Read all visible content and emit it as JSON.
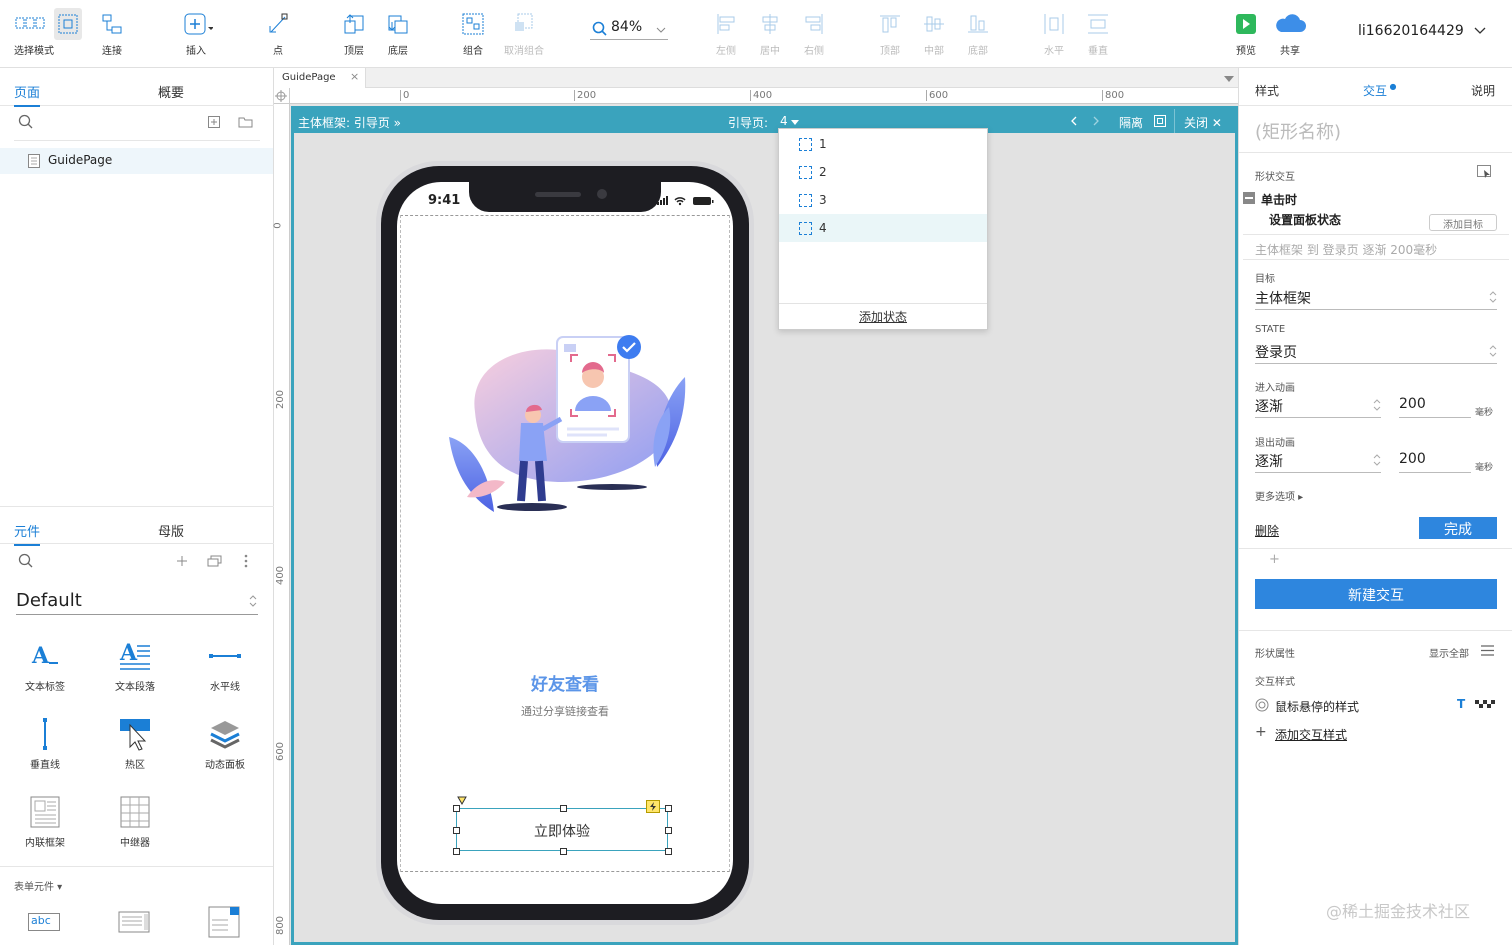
{
  "toolbar": {
    "select_mode": "选择模式",
    "connect": "连接",
    "insert": "插入",
    "point": "点",
    "top": "顶层",
    "bottom": "底层",
    "group": "组合",
    "ungroup": "取消组合",
    "zoom": "84%",
    "align_left": "左侧",
    "align_center": "居中",
    "align_right": "右侧",
    "align_top": "顶部",
    "align_middle": "中部",
    "align_bottom": "底部",
    "dist_h": "水平",
    "dist_v": "垂直",
    "preview": "预览",
    "share": "共享",
    "user": "li16620164429"
  },
  "left": {
    "tabs": [
      "页面",
      "概要"
    ],
    "page_item": "GuidePage",
    "lib_tabs": [
      "元件",
      "母版"
    ],
    "library": "Default",
    "widgets": [
      {
        "label": "文本标签",
        "icon": "text-label-icon"
      },
      {
        "label": "文本段落",
        "icon": "text-paragraph-icon"
      },
      {
        "label": "水平线",
        "icon": "horizontal-line-icon"
      },
      {
        "label": "垂直线",
        "icon": "vertical-line-icon"
      },
      {
        "label": "热区",
        "icon": "hotspot-icon"
      },
      {
        "label": "动态面板",
        "icon": "dynamic-panel-icon"
      },
      {
        "label": "内联框架",
        "icon": "inline-frame-icon"
      },
      {
        "label": "中继器",
        "icon": "repeater-icon"
      }
    ],
    "form_section": "表单元件",
    "form_first": "abc"
  },
  "canvas": {
    "tab": "GuidePage",
    "ruler_h": [
      "0",
      "200",
      "400",
      "600",
      "800"
    ],
    "ruler_v": [
      "0",
      "200",
      "400",
      "600",
      "800"
    ],
    "frame_title": "主体框架: 引导页",
    "frame_state_label": "引导页:",
    "frame_state_value": "4",
    "isolate": "隔离",
    "close": "关闭",
    "phone_time": "9:41",
    "headline": "好友查看",
    "subline": "通过分享链接查看",
    "cta": "立即体验"
  },
  "dropdown": {
    "items": [
      "1",
      "2",
      "3",
      "4"
    ],
    "add_state": "添加状态"
  },
  "right": {
    "tabs": [
      "样式",
      "交互",
      "说明"
    ],
    "shape_name": "(矩形名称)",
    "shape_interaction": "形状交互",
    "event": "单击时",
    "action": "设置面板状态",
    "add_target": "添加目标",
    "summary": "主体框架 到 登录页 逐渐 200毫秒",
    "target_label": "目标",
    "target_value": "主体框架",
    "state_label": "STATE",
    "state_value": "登录页",
    "enter_label": "进入动画",
    "enter_value": "逐渐",
    "enter_ms": "200",
    "exit_label": "退出动画",
    "exit_value": "逐渐",
    "exit_ms": "200",
    "ms_unit": "毫秒",
    "more_options": "更多选项",
    "delete": "删除",
    "done": "完成",
    "new_interaction": "新建交互",
    "shape_props": "形状属性",
    "show_all": "显示全部",
    "interaction_style": "交互样式",
    "hover_style": "鼠标悬停的样式",
    "add_style": "添加交互样式"
  },
  "watermark": "@稀土掘金技术社区",
  "colors": {
    "accent": "#1b7fd6",
    "frame": "#3aa3bd",
    "primary_button": "#2e86de",
    "headline": "#5b95e8"
  }
}
